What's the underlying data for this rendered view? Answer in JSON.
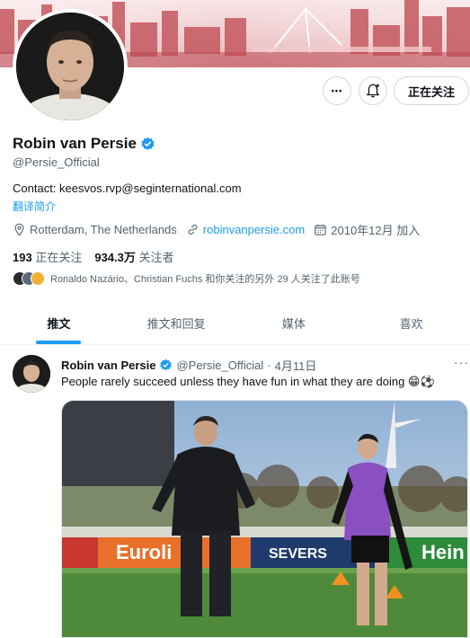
{
  "profile": {
    "name": "Robin van Persie",
    "handle": "@Persie_Official",
    "bio": "Contact: keesvos.rvp@seginternational.com",
    "translate_label": "翻译简介",
    "location": "Rotterdam, The Netherlands",
    "website": "robinvanpersie.com",
    "joined": "2010年12月 加入",
    "following_count": "193",
    "following_label": "正在关注",
    "followers_count": "934.3万",
    "followers_label": "关注者",
    "followed_by_text": "Ronaldo Nazário、Christian Fuchs 和你关注的另外 29 人关注了此账号"
  },
  "actions": {
    "more_label": "•••",
    "follow_label": "正在关注"
  },
  "tabs": [
    {
      "label": "推文"
    },
    {
      "label": "推文和回复"
    },
    {
      "label": "媒体"
    },
    {
      "label": "喜欢"
    }
  ],
  "tweet": {
    "name": "Robin van Persie",
    "handle": "@Persie_Official",
    "separator": "·",
    "date": "4月11日",
    "text": "People rarely succeed unless they have fun in what they are doing",
    "emoji": "😁⚽",
    "more_label": "···",
    "media_signage": [
      "Euroli",
      "SEVERS",
      "Hein"
    ]
  },
  "colors": {
    "accent": "#1d9bf0",
    "verified": "#1d9bf0",
    "secondary_text": "#536471",
    "banner": "#d9878e"
  },
  "icons": {
    "verified": "verified-badge-icon",
    "location": "location-pin-icon",
    "link": "link-icon",
    "calendar": "calendar-icon",
    "bell": "bell-plus-icon"
  }
}
